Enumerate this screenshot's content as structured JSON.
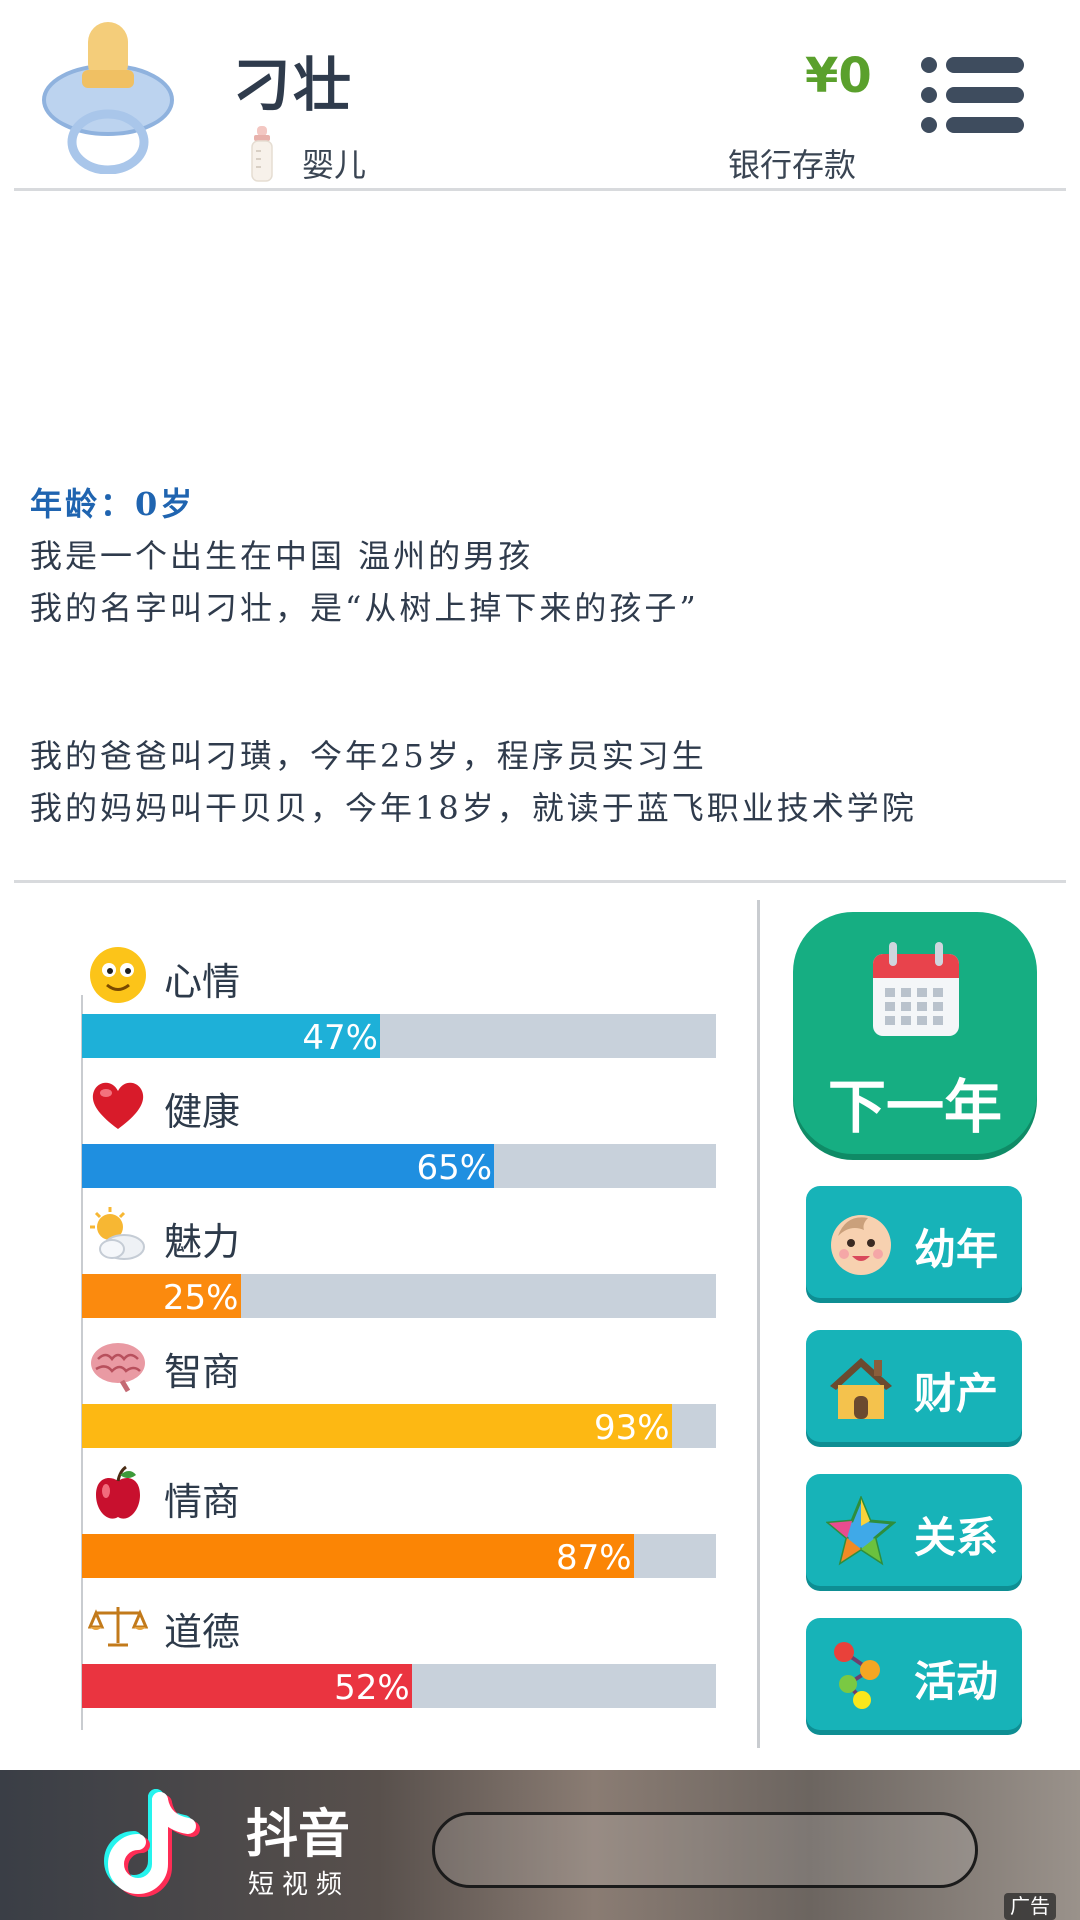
{
  "header": {
    "player_name": "刁壮",
    "stage_label": "婴儿",
    "money_value": "¥0",
    "money_label": "银行存款"
  },
  "story": {
    "age_line": "年龄：0岁",
    "line1": "我是一个出生在中国 温州的男孩",
    "line2": "我的名字叫刁壮，是“从树上掉下来的孩子”",
    "line3": "我的爸爸叫刁璜，今年25岁，程序员实习生",
    "line4": "我的妈妈叫干贝贝，今年18岁，就读于蓝飞职业技术学院"
  },
  "stats": [
    {
      "label": "心情",
      "value": 47,
      "text": "47%",
      "color": "#1eb0d8",
      "icon": "smiley-face-icon"
    },
    {
      "label": "健康",
      "value": 65,
      "text": "65%",
      "color": "#1f8fe0",
      "icon": "heart-icon"
    },
    {
      "label": "魅力",
      "value": 25,
      "text": "25%",
      "color": "#fb8a0e",
      "icon": "sun-cloud-icon"
    },
    {
      "label": "智商",
      "value": 93,
      "text": "93%",
      "color": "#fdb813",
      "icon": "brain-icon"
    },
    {
      "label": "情商",
      "value": 87,
      "text": "87%",
      "color": "#fb8505",
      "icon": "apple-icon"
    },
    {
      "label": "道德",
      "value": 52,
      "text": "52%",
      "color": "#ea3440",
      "icon": "scales-icon"
    }
  ],
  "actions": {
    "next_year": "下一年",
    "childhood": "幼年",
    "property": "财产",
    "relations": "关系",
    "activities": "活动"
  },
  "ad": {
    "title": "抖音",
    "subtitle": "短视频",
    "badge": "广告"
  }
}
